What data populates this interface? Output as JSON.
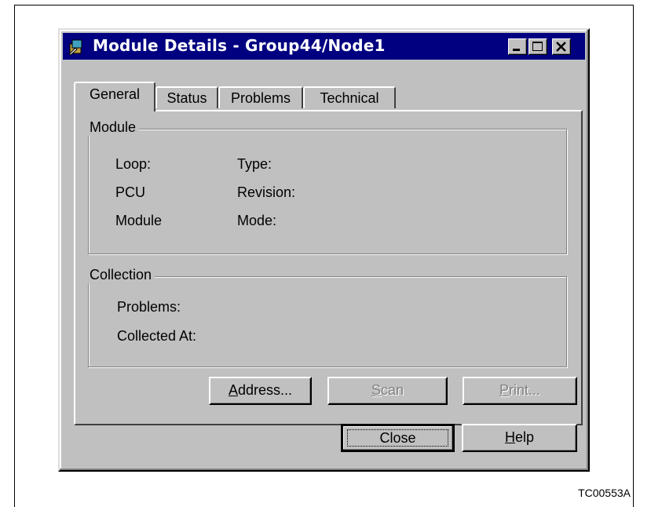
{
  "window": {
    "title": "Module Details - Group44/Node1",
    "icon": "module-app-icon"
  },
  "tabs": [
    {
      "label": "General",
      "active": true
    },
    {
      "label": "Status",
      "active": false
    },
    {
      "label": "Problems",
      "active": false
    },
    {
      "label": "Technical",
      "active": false
    }
  ],
  "module_group": {
    "legend": "Module",
    "fields": {
      "loop": "Loop:",
      "pcu": "PCU",
      "module": "Module",
      "type": "Type:",
      "revision": "Revision:",
      "mode": "Mode:"
    }
  },
  "collection_group": {
    "legend": "Collection",
    "fields": {
      "problems": "Problems:",
      "collected_at": "Collected At:"
    }
  },
  "buttons": {
    "address": {
      "prefix": "",
      "mnemonic": "A",
      "rest": "ddress...",
      "enabled": true
    },
    "scan": {
      "prefix": "",
      "mnemonic": "S",
      "rest": "can",
      "enabled": false
    },
    "print": {
      "prefix": "",
      "mnemonic": "P",
      "rest": "rint...",
      "enabled": false
    },
    "close": {
      "label": "Close",
      "default": true
    },
    "help": {
      "prefix": "",
      "mnemonic": "H",
      "rest": "elp"
    }
  },
  "caption": "TC00553A",
  "colors": {
    "titlebar": "#000080",
    "face": "#c0c0c0",
    "disabled_text": "#808080"
  }
}
